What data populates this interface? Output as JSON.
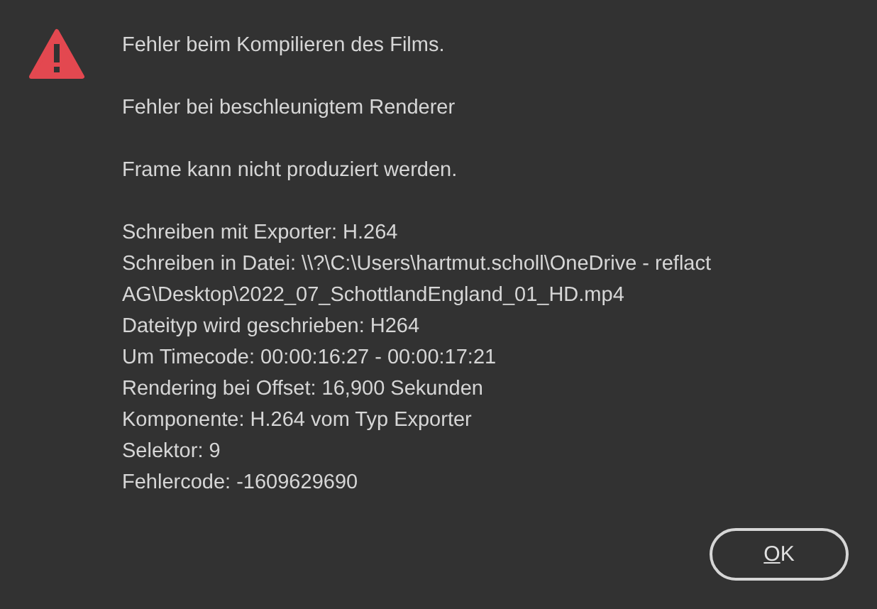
{
  "dialog": {
    "paragraphs": [
      [
        "Fehler beim Kompilieren des Films."
      ],
      [
        "Fehler bei beschleunigtem Renderer"
      ],
      [
        "Frame kann nicht produziert werden."
      ],
      [
        "Schreiben mit Exporter: H.264",
        "Schreiben in Datei: \\\\?\\C:\\Users\\hartmut.scholl\\OneDrive - reflact AG\\Desktop\\2022_07_SchottlandEngland_01_HD.mp4",
        "Dateityp wird geschrieben: H264",
        "Um Timecode: 00:00:16:27 - 00:00:17:21",
        "Rendering bei Offset: 16,900 Sekunden",
        "Komponente: H.264 vom Typ Exporter",
        "Selektor: 9",
        "Fehlercode: -1609629690"
      ]
    ],
    "buttons": [
      "OK"
    ]
  }
}
